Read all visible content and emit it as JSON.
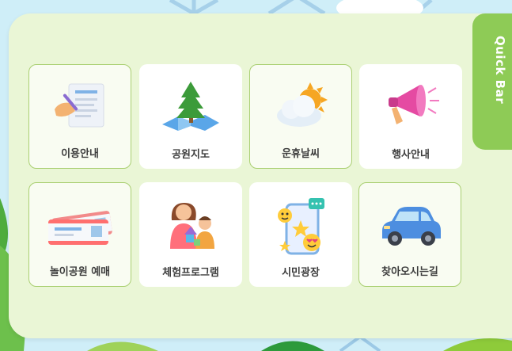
{
  "quick_menu": {
    "items": [
      {
        "label": "이용안내",
        "icon": "document-pen-icon"
      },
      {
        "label": "공원지도",
        "icon": "park-map-icon"
      },
      {
        "label": "운휴날씨",
        "icon": "weather-icon"
      },
      {
        "label": "행사안내",
        "icon": "megaphone-icon"
      },
      {
        "label": "놀이공원 예매",
        "icon": "ticket-icon"
      },
      {
        "label": "체험프로그램",
        "icon": "family-program-icon"
      },
      {
        "label": "시민광장",
        "icon": "social-chat-icon"
      },
      {
        "label": "찾아오시는길",
        "icon": "car-icon"
      }
    ]
  },
  "quickbar": {
    "label": "Quick Bar"
  },
  "colors": {
    "panel": "#eaf6d6",
    "accent": "#8ecb56",
    "card_border": "#a9cf71",
    "text": "#3d3d3d"
  }
}
